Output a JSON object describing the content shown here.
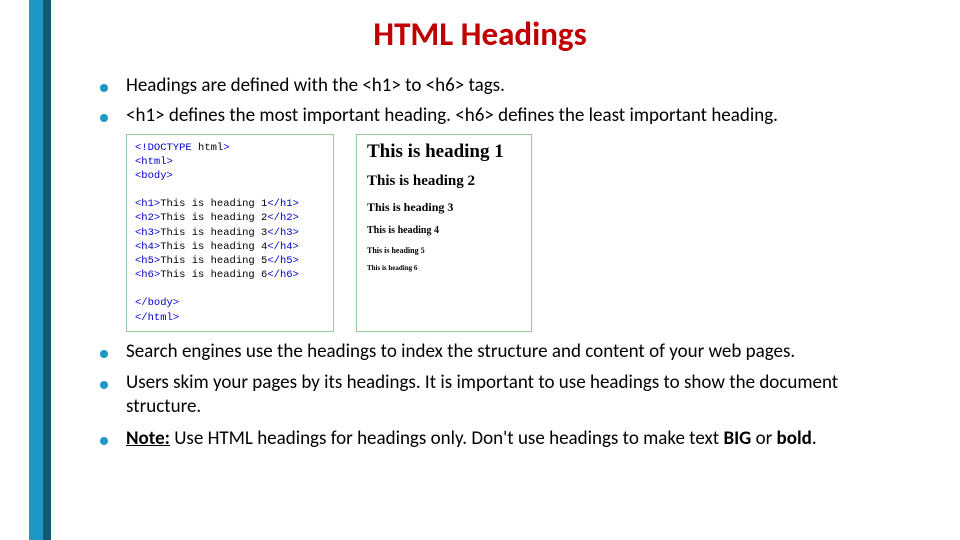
{
  "title": "HTML Headings",
  "bullets": {
    "b1": "Headings are defined with the <h1> to <h6> tags.",
    "b2": "<h1> defines the most important heading. <h6> defines the least important heading.",
    "b3": "Search engines use the headings to index the structure and content of your web pages.",
    "b4": "Users skim your pages by its headings. It is important to use headings to show the document structure.",
    "b5_note": "Note:",
    "b5_rest_a": " Use HTML headings for headings only. Don't use headings to make text ",
    "b5_big": "BIG",
    "b5_or": " or ",
    "b5_bold": "bold",
    "b5_period": "."
  },
  "code": {
    "l1a": "<!DOCTYPE ",
    "l1b": "html",
    "l1c": ">",
    "l2": "<html>",
    "l3": "<body>",
    "h1o": "<h1>",
    "h1t": "This is heading 1",
    "h1c": "</h1>",
    "h2o": "<h2>",
    "h2t": "This is heading 2",
    "h2c": "</h2>",
    "h3o": "<h3>",
    "h3t": "This is heading 3",
    "h3c": "</h3>",
    "h4o": "<h4>",
    "h4t": "This is heading 4",
    "h4c": "</h4>",
    "h5o": "<h5>",
    "h5t": "This is heading 5",
    "h5c": "</h5>",
    "h6o": "<h6>",
    "h6t": "This is heading 6",
    "h6c": "</h6>",
    "l10": "</body>",
    "l11": "</html>"
  },
  "render": {
    "h1": "This is heading 1",
    "h2": "This is heading 2",
    "h3": "This is heading 3",
    "h4": "This is heading 4",
    "h5": "This is heading 5",
    "h6": "This is heading 6"
  }
}
